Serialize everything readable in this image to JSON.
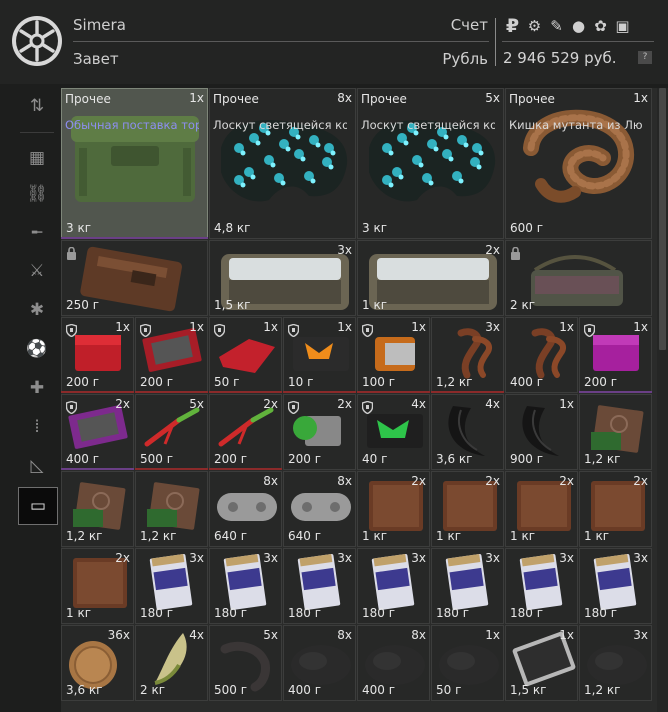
{
  "header": {
    "trader_name": "Simera",
    "account_label": "Счет",
    "subtitle": "Завет",
    "currency_label": "Рубль",
    "balance": "2 946 529 руб.",
    "help": "?",
    "currency_icons": [
      "ruble-icon",
      "gear-icon",
      "feather-icon",
      "circle-icon",
      "clover-icon",
      "shield-icon"
    ],
    "rub_glyph": "₽"
  },
  "sidebar": {
    "items": [
      {
        "name": "sort-icon",
        "glyph": "⇅"
      },
      {
        "name": "grid-icon",
        "glyph": "▦"
      },
      {
        "name": "link-icon",
        "glyph": "⛓"
      },
      {
        "name": "rifle-icon",
        "glyph": "╾"
      },
      {
        "name": "knife-icon",
        "glyph": "⚔"
      },
      {
        "name": "grenade-icon",
        "glyph": "✱"
      },
      {
        "name": "sphere-icon",
        "glyph": "⚽"
      },
      {
        "name": "medkit-icon",
        "glyph": "✚"
      },
      {
        "name": "ammo-icon",
        "glyph": "⦙"
      },
      {
        "name": "ruler-icon",
        "glyph": "◺"
      },
      {
        "name": "box-icon",
        "glyph": "▭"
      }
    ]
  },
  "items": [
    {
      "name": "Прочее",
      "desc": "Обычная поставка торг…",
      "count": "1x",
      "weight": "3 кг",
      "visual": "crate",
      "desc_color": "purple",
      "selected": true
    },
    {
      "name": "Прочее",
      "desc": "Лоскут светящейся кож…",
      "count": "8x",
      "weight": "4,8 кг",
      "visual": "glow"
    },
    {
      "name": "Прочее",
      "desc": "Лоскут светящейся кож…",
      "count": "5x",
      "weight": "3 кг",
      "visual": "glow"
    },
    {
      "name": "Прочее",
      "desc": "Кишка мутанта из Люб…",
      "count": "1x",
      "weight": "600 г",
      "visual": "gut"
    },
    {
      "count": "",
      "weight": "250 г",
      "visual": "wallet",
      "lock": true
    },
    {
      "count": "3x",
      "weight": "1,5 кг",
      "visual": "tray"
    },
    {
      "count": "2x",
      "weight": "1 кг",
      "visual": "tray"
    },
    {
      "count": "",
      "weight": "2 кг",
      "visual": "bag",
      "lock": true
    },
    {
      "count": "1x",
      "weight": "200 г",
      "visual": "redbox",
      "shield": true
    },
    {
      "count": "1x",
      "weight": "200 г",
      "visual": "redcase",
      "shield": true
    },
    {
      "count": "1x",
      "weight": "50 г",
      "visual": "redcloth",
      "shield": true
    },
    {
      "count": "1x",
      "weight": "10 г",
      "visual": "orangebox",
      "shield": true
    },
    {
      "count": "1x",
      "weight": "100 г",
      "visual": "orangedevice",
      "shield": true
    },
    {
      "count": "3x",
      "weight": "1,2 кг",
      "visual": "claw"
    },
    {
      "count": "1x",
      "weight": "400 г",
      "visual": "claw"
    },
    {
      "count": "1x",
      "weight": "200 г",
      "visual": "purplebox",
      "shield": true
    },
    {
      "count": "2x",
      "weight": "400 г",
      "visual": "purplecase",
      "shield": true
    },
    {
      "count": "5x",
      "weight": "500 г",
      "visual": "pliers"
    },
    {
      "count": "2x",
      "weight": "200 г",
      "visual": "pliers"
    },
    {
      "count": "2x",
      "weight": "200 г",
      "visual": "greendevice",
      "shield": true
    },
    {
      "count": "4x",
      "weight": "40 г",
      "visual": "greenbox",
      "shield": true
    },
    {
      "count": "4x",
      "weight": "3,6 кг",
      "visual": "horn"
    },
    {
      "count": "1x",
      "weight": "900 г",
      "visual": "horn"
    },
    {
      "count": "",
      "weight": "1,2 кг",
      "visual": "circuit"
    },
    {
      "count": "",
      "weight": "1,2 кг",
      "visual": "circuit"
    },
    {
      "count": "",
      "weight": "1,2 кг",
      "visual": "circuit"
    },
    {
      "count": "8x",
      "weight": "640 г",
      "visual": "gamepad"
    },
    {
      "count": "8x",
      "weight": "640 г",
      "visual": "gamepad"
    },
    {
      "count": "2x",
      "weight": "1 кг",
      "visual": "leather"
    },
    {
      "count": "2x",
      "weight": "1 кг",
      "visual": "leather"
    },
    {
      "count": "2x",
      "weight": "1 кг",
      "visual": "leather"
    },
    {
      "count": "2x",
      "weight": "1 кг",
      "visual": "leather"
    },
    {
      "count": "2x",
      "weight": "1 кг",
      "visual": "leather"
    },
    {
      "count": "3x",
      "weight": "180 г",
      "visual": "cigs"
    },
    {
      "count": "3x",
      "weight": "180 г",
      "visual": "cigs"
    },
    {
      "count": "3x",
      "weight": "180 г",
      "visual": "cigs"
    },
    {
      "count": "3x",
      "weight": "180 г",
      "visual": "cigs"
    },
    {
      "count": "3x",
      "weight": "180 г",
      "visual": "cigs"
    },
    {
      "count": "3x",
      "weight": "180 г",
      "visual": "cigs"
    },
    {
      "count": "3x",
      "weight": "180 г",
      "visual": "cigs"
    },
    {
      "count": "36x",
      "weight": "3,6 кг",
      "visual": "coin"
    },
    {
      "count": "4x",
      "weight": "2 кг",
      "visual": "tooth"
    },
    {
      "count": "5x",
      "weight": "500 г",
      "visual": "hook"
    },
    {
      "count": "8x",
      "weight": "400 г",
      "visual": "fur"
    },
    {
      "count": "8x",
      "weight": "400 г",
      "visual": "fur"
    },
    {
      "count": "1x",
      "weight": "50 г",
      "visual": "fur"
    },
    {
      "count": "1x",
      "weight": "1,5 кг",
      "visual": "plate"
    },
    {
      "count": "3x",
      "weight": "1,2 кг",
      "visual": "fur"
    }
  ],
  "card_icon_names": {
    "lock": "lock-icon",
    "shield": "shield-icon"
  },
  "colors": {
    "rarity_red": "#8b2a2a",
    "rarity_purple": "#6a3f86",
    "accent_purple": "#8d8ef0"
  }
}
